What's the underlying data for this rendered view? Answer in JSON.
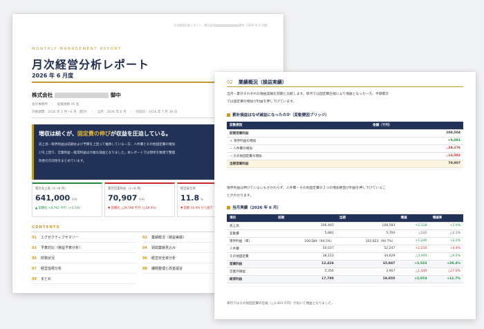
{
  "page1": {
    "running_header": "月次経営分析レポート｜株式会社",
    "running_header_tail": "御中（2026 年 6 月度）",
    "eyebrow": "MONTHLY MANAGEMENT REPORT",
    "title": "月次経営分析レポート",
    "period": "2026 年 6 月度",
    "company_prefix": "株式会社",
    "company_suffix": "御中",
    "meta_line1": "会計事務所　｜　従業員数 95 名",
    "meta_line2": "対象期間：2026 年 1 月〜6 月（累計）　｜　当月：2026 年 6 月　｜　作成日：2026 年 7 月 28 日",
    "banner": {
      "headline_pre": "増収は続くが、",
      "headline_em": "固定費の伸び",
      "headline_post": "が収益を圧迫している。",
      "body_line1": "売上高・限界利益は前期および予算を上回って推移している一方、人件費とその他固定費の増加",
      "body_line2": "びを上回り、営業利益・経常利益は大幅な減益となりました。本レポートでは現状を数値で整理",
      "body_line3": "改善の方向性をまとめています。"
    },
    "kpis": [
      {
        "label": "累計売上高（1〜6 月）",
        "value": "641,000",
        "unit": "千円",
        "sub": "▲ 前期比 +6,762 千円（+1.1%）",
        "trend": "up",
        "color": "#1b8a3d"
      },
      {
        "label": "累計営業利益（1〜6 月）",
        "value": "70,907",
        "unit": "千円",
        "sub": "▼ 前期比 △29,598 千円（△29.4%）",
        "trend": "down",
        "color": "#c62828"
      },
      {
        "label": "経営安全率",
        "value": "11.8",
        "unit": "%",
        "sub": "▼ 前期 16.9% から低下",
        "trend": "down",
        "color": "#c62828"
      }
    ],
    "contents_title": "CONTENTS",
    "contents": [
      {
        "no": "01",
        "label": "エグゼクティブサマリー"
      },
      {
        "no": "02",
        "label": "業績概況（損益実績）"
      },
      {
        "no": "03",
        "label": "予算対比（損益予算分析）"
      },
      {
        "no": "04",
        "label": "週間業績見込み"
      },
      {
        "no": "05",
        "label": "財務状況"
      },
      {
        "no": "06",
        "label": "経営安全率分析"
      },
      {
        "no": "07",
        "label": "経営指標分析"
      },
      {
        "no": "08",
        "label": "課題整理と改善提言"
      },
      {
        "no": "09",
        "label": "まとめ"
      }
    ]
  },
  "page2": {
    "section_no": "02",
    "section_title": "業績概況（損益実績）",
    "intro_line1": "当月・累計それぞれの損益実績を前期と比較します。単月では固定費圧縮により増益となった一方、半期累計",
    "intro_line2": "では固定費の増加が利益を押し下げています。",
    "bridge_title": "累計損益はなぜ減益になったのか（変動要因ブリッジ）",
    "bridge_headers": [
      "変動要因",
      "金額（千円）"
    ],
    "bridge_rows": [
      {
        "label": "前期営業利益",
        "value": "100,504",
        "cls": "bold",
        "color": "#333333"
      },
      {
        "label": "＋ 限界利益の増加",
        "value": "+8,081",
        "cls": "",
        "color": "#1b8a3d"
      },
      {
        "label": "− 人件費の増加",
        "value": "△24,176",
        "cls": "",
        "color": "#c62828"
      },
      {
        "label": "− その他固定費の増加",
        "value": "△13,502",
        "cls": "",
        "color": "#c62828"
      },
      {
        "label": "当期営業利益",
        "value": "70,907",
        "cls": "bold hl",
        "color": "#333333"
      }
    ],
    "bridge_note_line1": "限界利益は伸びているにもかかわらず、人件費・その他固定費の２つの増加要因が利益を押し下げているこ",
    "bridge_note_line2": "とがわかります。",
    "results_title": "当月実績（2026 年 6 月）",
    "results_headers": [
      "項目",
      "前期",
      "当期",
      "増減",
      "増減率"
    ],
    "results_rows": [
      {
        "item": "売上高",
        "prev": "106,465",
        "curr": "108,583",
        "diff": "+2,118",
        "rate": "+2.0%",
        "bold": false,
        "dc": "#1b8a3d",
        "rc": "#1b8a3d"
      },
      {
        "item": "変動費",
        "prev": "5,882",
        "curr": "5,760",
        "diff": "△122",
        "rate": "△2.1%",
        "bold": false,
        "dc": "#555555",
        "rc": "#555555"
      },
      {
        "item": "限界利益（率）",
        "prev": "100,584（94.5%）",
        "curr": "102,823（94.7%）",
        "diff": "+2,240",
        "rate": "+2.2%",
        "bold": false,
        "dc": "#1b8a3d",
        "rc": "#1b8a3d"
      },
      {
        "item": "人件費",
        "prev": "50,037",
        "curr": "52,247",
        "diff": "+2,210",
        "rate": "+4.4%",
        "bold": false,
        "dc": "#c62828",
        "rc": "#c62828"
      },
      {
        "item": "その他固定費",
        "prev": "38,122",
        "curr": "34,629",
        "diff": "△3,493",
        "rate": "△9.2%",
        "bold": false,
        "dc": "#1b8a3d",
        "rc": "#1b8a3d"
      },
      {
        "item": "営業利益",
        "prev": "12,424",
        "curr": "15,947",
        "diff": "+3,523",
        "rate": "+28.4%",
        "bold": true,
        "dc": "#1b8a3d",
        "rc": "#1b8a3d"
      },
      {
        "item": "営業外損益",
        "prev": "5,356",
        "curr": "3,907",
        "diff": "△1,449",
        "rate": "△27.0%",
        "bold": false,
        "dc": "#c62828",
        "rc": "#c62828"
      },
      {
        "item": "経常利益",
        "prev": "17,780",
        "curr": "19,855",
        "diff": "+2,074",
        "rate": "+11.7%",
        "bold": true,
        "dc": "#1b8a3d",
        "rc": "#1b8a3d"
      }
    ],
    "footnote": "単月ではその他固定費の圧縮（△3,493 千円）が効いて増益となりました。"
  }
}
